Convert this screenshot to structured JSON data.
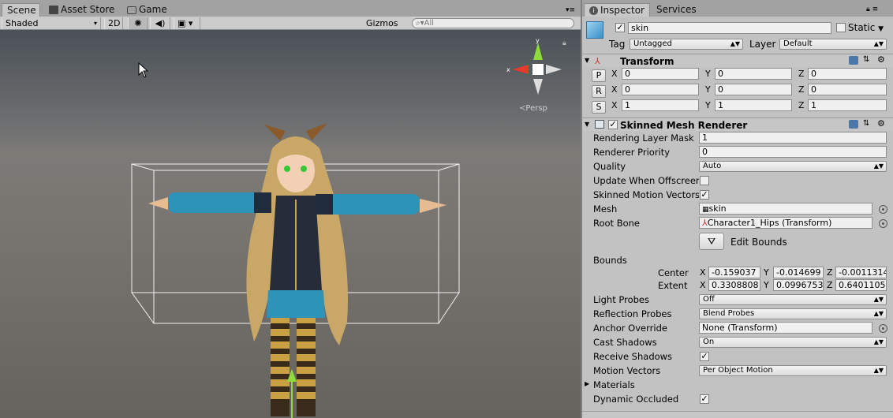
{
  "scene_tabs": [
    {
      "label": "Scene"
    },
    {
      "label": "Asset Store"
    },
    {
      "label": "Game"
    }
  ],
  "scene_toolbar": {
    "shading": "Shaded",
    "mode_2d": "2D",
    "gizmos": "Gizmos",
    "search_placeholder": "All"
  },
  "gizmo": {
    "persp_label": "Persp"
  },
  "inspector_tabs": [
    {
      "label": "Inspector"
    },
    {
      "label": "Services"
    }
  ],
  "object": {
    "name": "skin",
    "active": true,
    "static_label": "Static",
    "tag_label": "Tag",
    "tag": "Untagged",
    "layer_label": "Layer",
    "layer": "Default"
  },
  "transform": {
    "title": "Transform",
    "rows": [
      {
        "btn": "P",
        "x": "0",
        "y": "0",
        "z": "0"
      },
      {
        "btn": "R",
        "x": "0",
        "y": "0",
        "z": "0"
      },
      {
        "btn": "S",
        "x": "1",
        "y": "1",
        "z": "1"
      }
    ]
  },
  "axes": {
    "x": "X",
    "y": "Y",
    "z": "Z"
  },
  "smr": {
    "title": "Skinned Mesh Renderer",
    "rendering_layer_mask": {
      "label": "Rendering Layer Mask",
      "value": "1"
    },
    "renderer_priority": {
      "label": "Renderer Priority",
      "value": "0"
    },
    "quality": {
      "label": "Quality",
      "value": "Auto"
    },
    "update_offscreen": {
      "label": "Update When Offscreen"
    },
    "skinned_motion": {
      "label": "Skinned Motion Vectors"
    },
    "mesh": {
      "label": "Mesh",
      "value": "skin"
    },
    "root_bone": {
      "label": "Root Bone",
      "value": "Character1_Hips (Transform)"
    },
    "edit_bounds": "Edit Bounds",
    "bounds_label": "Bounds",
    "center": {
      "label": "Center",
      "x": "-0.159037",
      "y": "-0.014699",
      "z": "-0.0011314"
    },
    "extent": {
      "label": "Extent",
      "x": "0.3308808",
      "y": "0.0996753",
      "z": "0.6401105"
    },
    "light_probes": {
      "label": "Light Probes",
      "value": "Off"
    },
    "reflection_probes": {
      "label": "Reflection Probes",
      "value": "Blend Probes"
    },
    "anchor_override": {
      "label": "Anchor Override",
      "value": "None (Transform)"
    },
    "cast_shadows": {
      "label": "Cast Shadows",
      "value": "On"
    },
    "receive_shadows": {
      "label": "Receive Shadows"
    },
    "motion_vectors": {
      "label": "Motion Vectors",
      "value": "Per Object Motion"
    },
    "materials": {
      "label": "Materials"
    },
    "dynamic_occluded": {
      "label": "Dynamic Occluded"
    }
  }
}
